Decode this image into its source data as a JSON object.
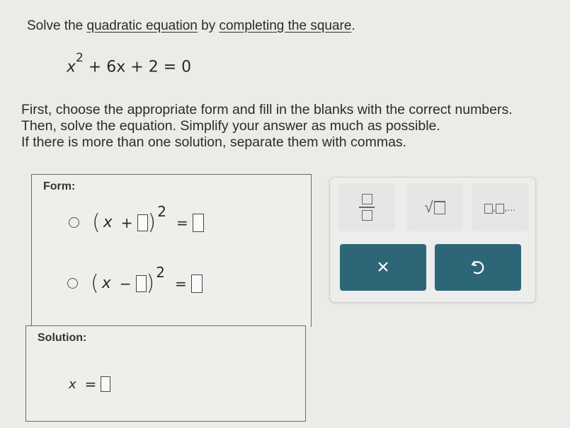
{
  "question": {
    "intro_start": "Solve the ",
    "link1": "quadratic equation",
    "intro_mid": " by ",
    "link2": "completing the square",
    "intro_end": "."
  },
  "equation": {
    "var": "x",
    "exp": "2",
    "rest": " + 6x + 2 = 0"
  },
  "instructions": [
    "First, choose the appropriate form and fill in the blanks with the correct numbers.",
    "Then, solve the equation. Simplify your answer as much as possible.",
    "If there is more than one solution, separate them with commas."
  ],
  "form_panel": {
    "label": "Form:",
    "options": [
      {
        "open": "(",
        "var": "x",
        "op": "+",
        "close": ")",
        "exp": "2",
        "eq": "="
      },
      {
        "open": "(",
        "var": "x",
        "op": "−",
        "close": ")",
        "exp": "2",
        "eq": "="
      }
    ]
  },
  "solution_panel": {
    "label": "Solution:",
    "var": "x",
    "eq": "="
  },
  "keypad": {
    "list_suffix": ",...",
    "clear_symbol": "×",
    "undo_icon": "undo-icon"
  }
}
